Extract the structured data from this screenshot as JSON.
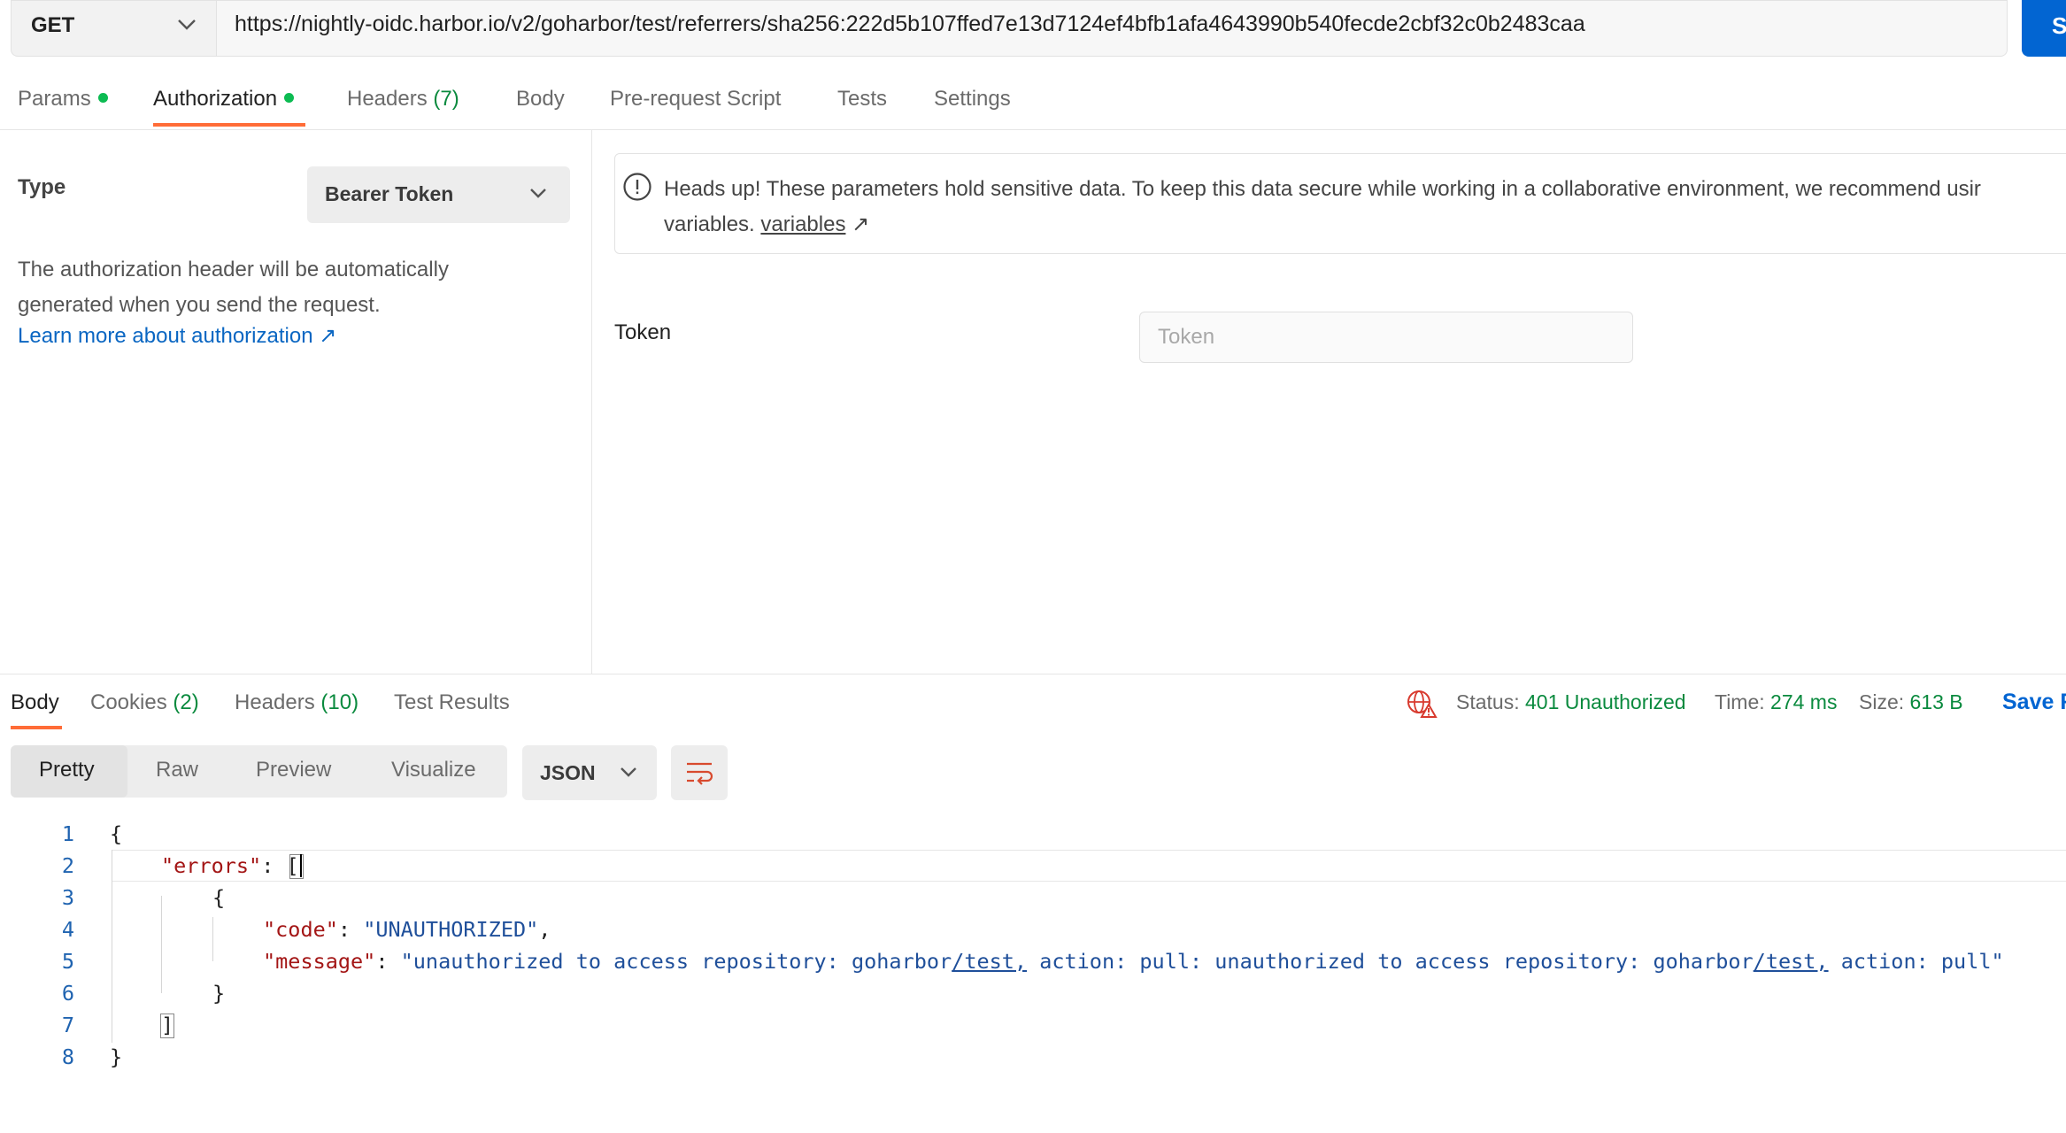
{
  "request": {
    "method": "GET",
    "url": "https://nightly-oidc.harbor.io/v2/goharbor/test/referrers/sha256:222d5b107ffed7e13d7124ef4bfb1afa4643990b540fecde2cbf32c0b2483caa",
    "send_label": "S"
  },
  "request_tabs": {
    "params": "Params",
    "authorization": "Authorization",
    "headers": "Headers",
    "headers_count": "(7)",
    "body": "Body",
    "pre_request": "Pre-request Script",
    "tests": "Tests",
    "settings": "Settings"
  },
  "auth": {
    "type_label": "Type",
    "type_value": "Bearer Token",
    "description": "The authorization header will be automatically generated when you send the request.",
    "learn_more": "Learn more about authorization ↗",
    "banner_text": "Heads up! These parameters hold sensitive data. To keep this data secure while working in a collaborative environment, we recommend usir",
    "banner_text2": "variables.",
    "banner_link": "variables",
    "banner_arrow": "↗",
    "token_label": "Token",
    "token_placeholder": "Token"
  },
  "response_tabs": {
    "body": "Body",
    "cookies": "Cookies",
    "cookies_count": "(2)",
    "headers": "Headers",
    "headers_count": "(10)",
    "test_results": "Test Results"
  },
  "response_status": {
    "status_label": "Status:",
    "status_value": "401 Unauthorized",
    "time_label": "Time:",
    "time_value": "274 ms",
    "size_label": "Size:",
    "size_value": "613 B",
    "save_label": "Save R"
  },
  "format": {
    "modes": [
      "Pretty",
      "Raw",
      "Preview",
      "Visualize"
    ],
    "language": "JSON"
  },
  "code": {
    "line_numbers": [
      "1",
      "2",
      "3",
      "4",
      "5",
      "6",
      "7",
      "8"
    ],
    "open_brace": "{",
    "errors_key": "\"errors\"",
    "open_bracket": "[",
    "inner_open": "{",
    "code_key": "\"code\"",
    "code_value": "\"UNAUTHORIZED\"",
    "message_key": "\"message\"",
    "message_value_a": "\"unauthorized to access repository: goharbor",
    "message_value_b": "/test,",
    "message_value_c": " action: pull: unauthorized to access repository: goharbor",
    "message_value_d": "/test,",
    "message_value_e": " action: pull\"",
    "inner_close": "}",
    "close_bracket": "]",
    "close_brace": "}"
  },
  "colors": {
    "accent": "#ff6c37",
    "primary": "#0265d2",
    "success": "#0a8a3e",
    "error_icon": "#d83a2e"
  }
}
